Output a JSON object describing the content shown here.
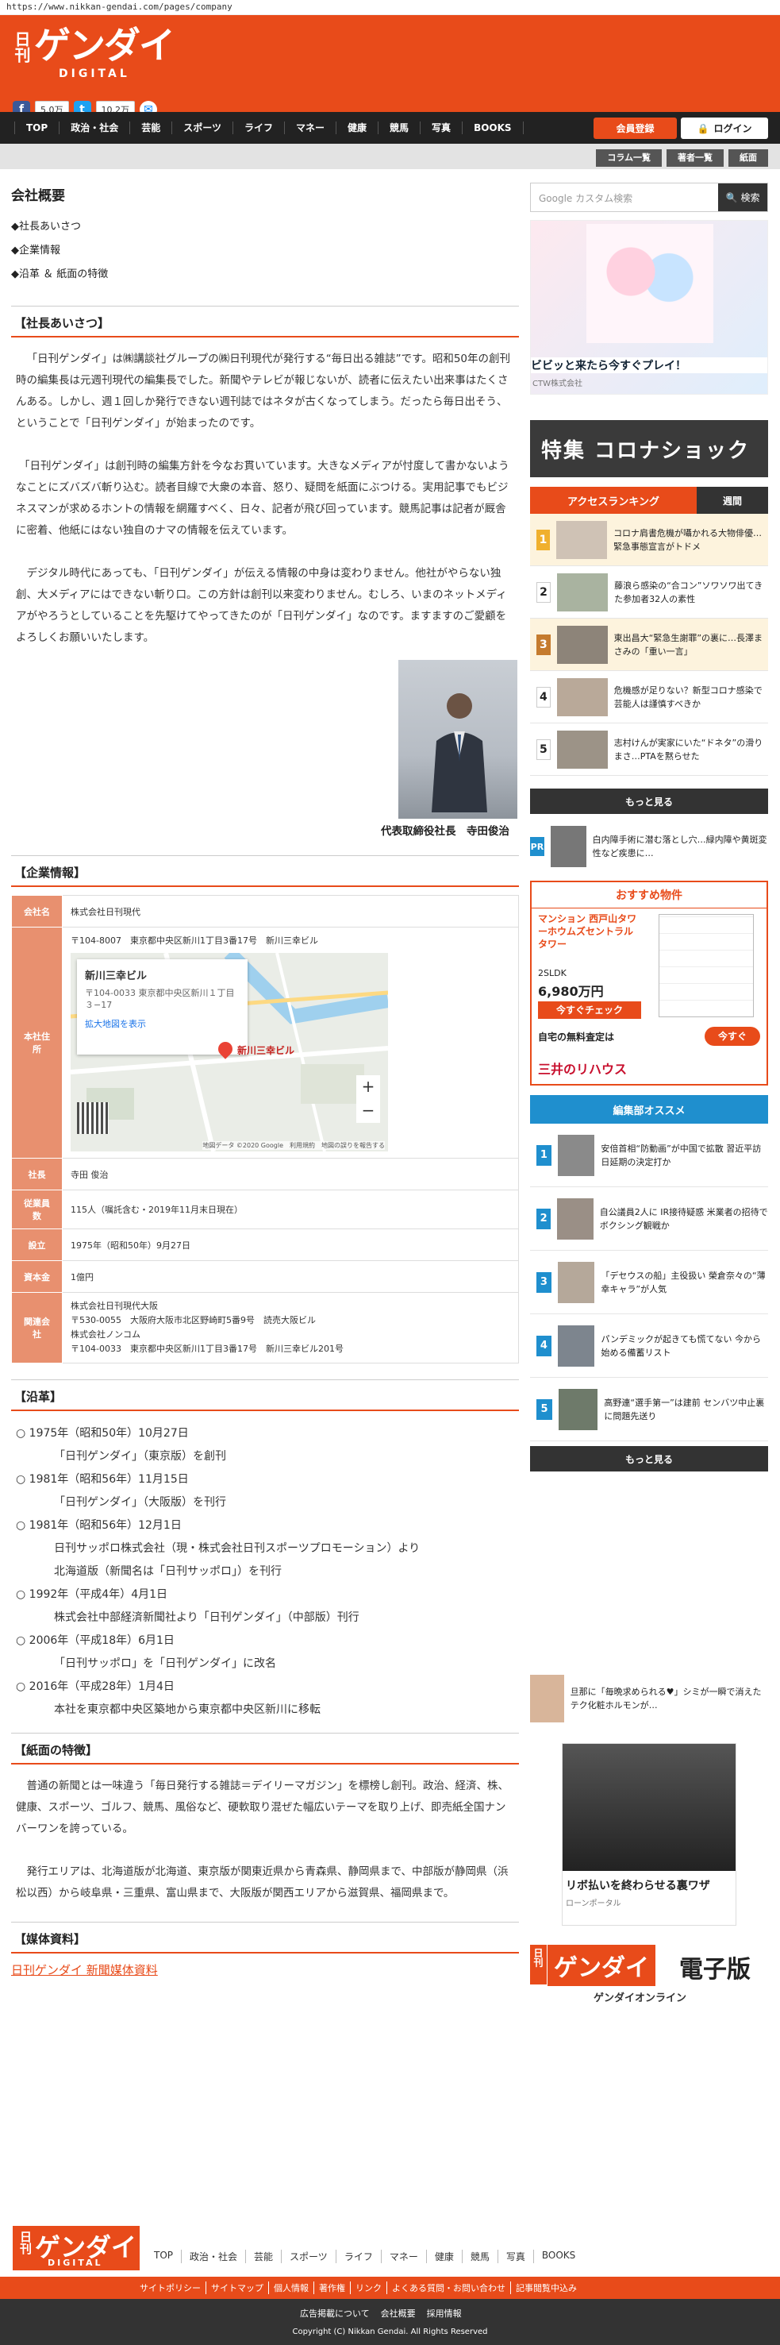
{
  "url": "https://www.nikkan-gendai.com/pages/company",
  "header": {
    "logo_nikkan": "日刊",
    "logo_gendai": "ゲンダイ",
    "logo_digital": "DIGITAL",
    "fb_count": "5.0万",
    "tw_count": "10.2万"
  },
  "nav": [
    "TOP",
    "政治・社会",
    "芸能",
    "スポーツ",
    "ライフ",
    "マネー",
    "健康",
    "競馬",
    "写真",
    "BOOKS"
  ],
  "register": "会員登録",
  "login": "ログイン",
  "subnav": [
    "コラム一覧",
    "著者一覧",
    "紙面"
  ],
  "page_title": "会社概要",
  "toc": [
    "◆社長あいさつ",
    "◆企業情報",
    "◆沿革 ＆ 紙面の特徴"
  ],
  "s1": {
    "heading": "【社長あいさつ】",
    "p1": "「日刊ゲンダイ」は㈱講談社グループの㈱日刊現代が発行する“毎日出る雑誌”です。昭和50年の創刊時の編集長は元週刊現代の編集長でした。新聞やテレビが報じないが、読者に伝えたい出来事はたくさんある。しかし、週１回しか発行できない週刊誌ではネタが古くなってしまう。だったら毎日出そう、ということで「日刊ゲンダイ」が始まったのです。",
    "p2": "「日刊ゲンダイ」は創刊時の編集方針を今なお貫いています。大きなメディアが忖度して書かないようなことにズバズバ斬り込む。読者目線で大衆の本音、怒り、疑問を紙面にぶつける。実用記事でもビジネスマンが求めるホントの情報を網羅すべく、日々、記者が飛び回っています。競馬記事は記者が厩舎に密着、他紙にはない独自のナマの情報を伝えています。",
    "p3": "デジタル時代にあっても、「日刊ゲンダイ」が伝える情報の中身は変わりません。他社がやらない独創、大メディアにはできない斬り口。この方針は創刊以来変わりません。むしろ、いまのネットメディアがやろうとしていることを先駆けてやってきたのが「日刊ゲンダイ」なのです。ますますのご愛顧をよろしくお願いいたします。",
    "ceo": "代表取締役社長　寺田俊治"
  },
  "s2": {
    "heading": "【企業情報】",
    "rows": [
      {
        "label": "会社名",
        "value": "株式会社日刊現代"
      },
      {
        "label": "本社住所",
        "value": "〒104-8007　東京都中央区新川1丁目3番17号　新川三幸ビル"
      },
      {
        "label": "社長",
        "value": "寺田 俊治"
      },
      {
        "label": "従業員数",
        "value": "115人（嘱託含む・2019年11月末日現在）"
      },
      {
        "label": "設立",
        "value": "1975年（昭和50年）9月27日"
      },
      {
        "label": "資本金",
        "value": "1億円"
      },
      {
        "label": "関連会社",
        "value": "株式会社日刊現代大阪"
      }
    ],
    "related": [
      "株式会社日刊現代大阪",
      "〒530-0055　大阪府大阪市北区野崎町5番9号　読売大阪ビル",
      "株式会社ノンコム",
      "〒104-0033　東京都中央区新川1丁目3番17号　新川三幸ビル201号"
    ],
    "map": {
      "title": "新川三幸ビル",
      "addr": "〒104-0033 東京都中央区新川１丁目３−17",
      "link": "拡大地図を表示",
      "pin": "新川三幸ビル",
      "copy": "地図データ ©2020 Google　利用規約　地図の誤りを報告する"
    }
  },
  "s3": {
    "heading": "【沿革】",
    "items": [
      {
        "date": "○ 1975年（昭和50年）10月27日",
        "text": "「日刊ゲンダイ」（東京版）を創刊"
      },
      {
        "date": "○ 1981年（昭和56年）11月15日",
        "text": "「日刊ゲンダイ」（大阪版）を刊行"
      },
      {
        "date": "○ 1981年（昭和56年）12月1日",
        "text": "日刊サッポロ株式会社（現・株式会社日刊スポーツプロモーション）より",
        "text2": "北海道版（新聞名は「日刊サッポロ」）を刊行"
      },
      {
        "date": "○ 1992年（平成4年）4月1日",
        "text": "株式会社中部経済新聞社より「日刊ゲンダイ」（中部版）刊行"
      },
      {
        "date": "○ 2006年（平成18年）6月1日",
        "text": "「日刊サッポロ」を「日刊ゲンダイ」に改名"
      },
      {
        "date": "○ 2016年（平成28年）1月4日",
        "text": "本社を東京都中央区築地から東京都中央区新川に移転"
      }
    ]
  },
  "s4": {
    "heading": "【紙面の特徴】",
    "p1": "普通の新聞とは一味違う「毎日発行する雑誌＝デイリーマガジン」を標榜し創刊。政治、経済、株、健康、スポーツ、ゴルフ、競馬、風俗など、硬軟取り混ぜた幅広いテーマを取り上げ、即売紙全国ナンバーワンを誇っている。",
    "p2": "発行エリアは、北海道版が北海道、東京版が関東近県から青森県、静岡県まで、中部版が静岡県（浜松以西）から岐阜県・三重県、富山県まで、大阪版が関西エリアから滋賀県、福岡県まで。"
  },
  "s5": {
    "heading": "【媒体資料】",
    "link": "日刊ゲンダイ 新聞媒体資料"
  },
  "side": {
    "search_placeholder": "Google カスタム検索",
    "search_btn": "検索",
    "ad1_caption": "ビビッと来たら今すぐプレイ！",
    "ad1_sub": "CTW株式会社",
    "corona": "特集 コロナショック",
    "rank_tab1": "アクセスランキング",
    "rank_tab2": "週間",
    "ranking": [
      {
        "n": "1",
        "t": "コロナ肩書危機が囁かれる大物俳優…緊急事態宣言がトドメ"
      },
      {
        "n": "2",
        "t": "藤浪ら感染の“合コン”ソワソワ出てきた参加者32人の素性"
      },
      {
        "n": "3",
        "t": "東出昌大“緊急生謝罪”の裏に…長澤まさみの「重い一言」"
      },
      {
        "n": "4",
        "t": "危機感が足りない？新型コロナ感染で芸能人は謹慎すべきか"
      },
      {
        "n": "5",
        "t": "志村けんが実家にいた“ドネタ”の滑りまさ…PTAを黙らせた"
      }
    ],
    "more": "もっと見る",
    "pr_text": "白内障手術に潜む落とし穴…緑内障や黄斑変性など疾患に…",
    "house_title": "おすすめ物件",
    "house_name": "マンション 西戸山タワーホウムズセントラルタワー",
    "house_ldk": "2SLDK",
    "house_price": "6,980万円",
    "house_btn": "今すぐチェック",
    "house_q": "自宅の無料査定は",
    "house_q_btn": "今すぐ",
    "house_brand": "三井のリハウス",
    "ed_head": "編集部オススメ",
    "editor": [
      {
        "n": "1",
        "t": "安倍首相“防動画”が中国で拡散 習近平訪日延期の決定打か"
      },
      {
        "n": "2",
        "t": "自公議員2人に IR接待疑惑 米業者の招待でボクシング観戦か"
      },
      {
        "n": "3",
        "t": "「デセウスの船」主役扱い 榮倉奈々の“薄幸キャラ”が人気"
      },
      {
        "n": "4",
        "t": "パンデミックが起きても慌てない 今から始める備蓄リスト"
      },
      {
        "n": "5",
        "t": "高野連“選手第一”は建前 センバツ中止裏に問題先送り"
      }
    ],
    "pr2_text": "旦那に「毎晩求められる♥」シミが一瞬で消えたテク化粧ホルモンが…",
    "ad2_caption": "リボ払いを終わらせる裏ワザ",
    "ad2_sub": "ローンポータル",
    "ebook_a": "日刊",
    "ebook_b": "ゲンダイ",
    "ebook_c": "電子版",
    "ebook_d": "ゲンダイオンライン"
  },
  "footer": {
    "nav": [
      "TOP",
      "政治・社会",
      "芸能",
      "スポーツ",
      "ライフ",
      "マネー",
      "健康",
      "競馬",
      "写真",
      "BOOKS"
    ],
    "links": [
      "サイトポリシー",
      "サイトマップ",
      "個人情報",
      "著作権",
      "リンク",
      "よくある質問・お問い合わせ",
      "記事閲覧中込み"
    ],
    "links2": [
      "広告掲載について",
      "会社概要",
      "採用情報"
    ],
    "copy": "Copyright (C) Nikkan Gendai. All Rights Reserved"
  }
}
